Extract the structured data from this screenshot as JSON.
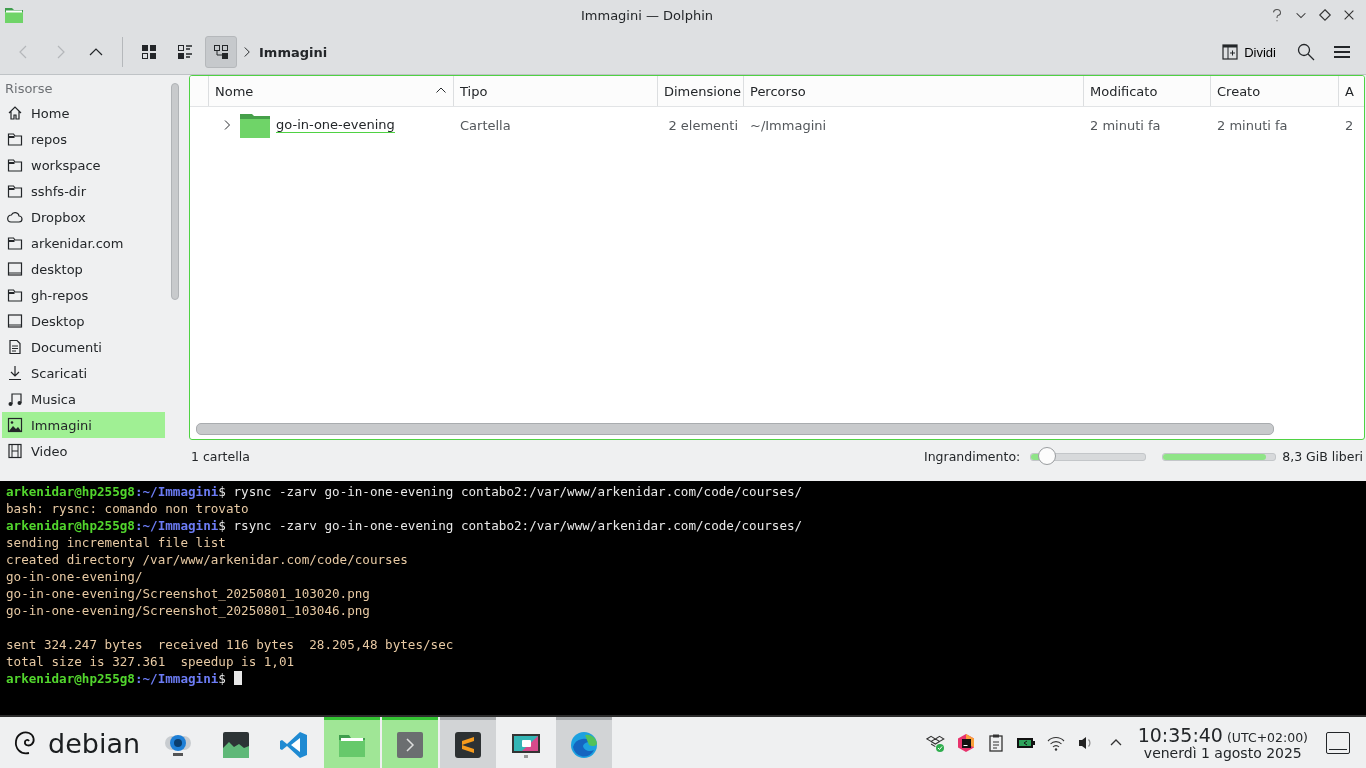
{
  "window": {
    "title": "Immagini — Dolphin"
  },
  "toolbar": {
    "breadcrumb": "Immagini",
    "split_label": "Dividi",
    "views": [
      {
        "kind": "icons",
        "selected": false
      },
      {
        "kind": "compact",
        "selected": false
      },
      {
        "kind": "details",
        "selected": true
      }
    ]
  },
  "sidebar": {
    "heading": "Risorse",
    "items": [
      {
        "label": "Home",
        "kind": "home",
        "selected": false
      },
      {
        "label": "repos",
        "kind": "folder",
        "selected": false
      },
      {
        "label": "workspace",
        "kind": "folder",
        "selected": false
      },
      {
        "label": "sshfs-dir",
        "kind": "folder",
        "selected": false
      },
      {
        "label": "Dropbox",
        "kind": "cloud",
        "selected": false
      },
      {
        "label": "arkenidar.com",
        "kind": "folder",
        "selected": false
      },
      {
        "label": "desktop",
        "kind": "desktop",
        "selected": false
      },
      {
        "label": "gh-repos",
        "kind": "folder",
        "selected": false
      },
      {
        "label": "Desktop",
        "kind": "desktop",
        "selected": false
      },
      {
        "label": "Documenti",
        "kind": "document",
        "selected": false
      },
      {
        "label": "Scaricati",
        "kind": "download",
        "selected": false
      },
      {
        "label": "Musica",
        "kind": "music",
        "selected": false
      },
      {
        "label": "Immagini",
        "kind": "image",
        "selected": true
      },
      {
        "label": "Video",
        "kind": "video",
        "selected": false
      }
    ]
  },
  "table": {
    "columns": [
      {
        "label": "Nome",
        "sorted": true
      },
      {
        "label": "Tipo",
        "sorted": false
      },
      {
        "label": "Dimensione",
        "sorted": false
      },
      {
        "label": "Percorso",
        "sorted": false
      },
      {
        "label": "Modificato",
        "sorted": false
      },
      {
        "label": "Creato",
        "sorted": false
      },
      {
        "label": "A",
        "sorted": false
      }
    ],
    "rows": [
      {
        "cells": [
          "go-in-one-evening",
          "Cartella",
          "2 elementi",
          "~/Immagini",
          "2 minuti fa",
          "2 minuti fa",
          "2"
        ],
        "expanded": false
      }
    ]
  },
  "status_bar": {
    "summary": "1 cartella",
    "zoom_label": "Ingrandimento:",
    "zoom": {
      "level": 0.14
    },
    "space": {
      "level": 0.92
    },
    "free_space": "8,3 GiB liberi"
  },
  "terminal": {
    "lines": [
      {
        "kind": "prompt",
        "user": "arkenidar@hp255g8",
        "path": ":~/Immagini",
        "command": "$ rysnc -zarv go-in-one-evening contabo2:/var/www/arkenidar.com/code/courses/",
        "cursor": false
      },
      {
        "kind": "output",
        "text": "bash: rysnc: comando non trovato"
      },
      {
        "kind": "prompt",
        "user": "arkenidar@hp255g8",
        "path": ":~/Immagini",
        "command": "$ rsync -zarv go-in-one-evening contabo2:/var/www/arkenidar.com/code/courses/",
        "cursor": false
      },
      {
        "kind": "output",
        "text": "sending incremental file list"
      },
      {
        "kind": "output",
        "text": "created directory /var/www/arkenidar.com/code/courses"
      },
      {
        "kind": "output",
        "text": "go-in-one-evening/"
      },
      {
        "kind": "output",
        "text": "go-in-one-evening/Screenshot_20250801_103020.png"
      },
      {
        "kind": "output",
        "text": "go-in-one-evening/Screenshot_20250801_103046.png"
      },
      {
        "kind": "blank"
      },
      {
        "kind": "output",
        "text": "sent 324.247 bytes  received 116 bytes  28.205,48 bytes/sec"
      },
      {
        "kind": "output",
        "text": "total size is 327.361  speedup is 1,01"
      },
      {
        "kind": "prompt",
        "user": "arkenidar@hp255g8",
        "path": ":~/Immagini",
        "command": "$",
        "cursor": true
      }
    ]
  },
  "taskbar": {
    "menu_label": "debian",
    "tasks": [
      {
        "kind": "webcam",
        "open": false,
        "active": false
      },
      {
        "kind": "monitor",
        "open": false,
        "active": false
      },
      {
        "kind": "code",
        "open": false,
        "active": false
      },
      {
        "kind": "files",
        "open": true,
        "active": true
      },
      {
        "kind": "terminal",
        "open": true,
        "active": true
      },
      {
        "kind": "sublime",
        "open": true,
        "active": false
      },
      {
        "kind": "screenshot",
        "open": false,
        "active": false
      },
      {
        "kind": "edge",
        "open": true,
        "active": false
      }
    ],
    "tray": [
      {
        "kind": "dropbox"
      },
      {
        "kind": "toolbox"
      },
      {
        "kind": "clipboard"
      },
      {
        "kind": "battery"
      },
      {
        "kind": "wifi"
      },
      {
        "kind": "volume"
      },
      {
        "kind": "expand"
      }
    ],
    "time": "10:35:40",
    "timezone": "(UTC+02:00)",
    "date": "venerdì 1 agosto 2025"
  }
}
